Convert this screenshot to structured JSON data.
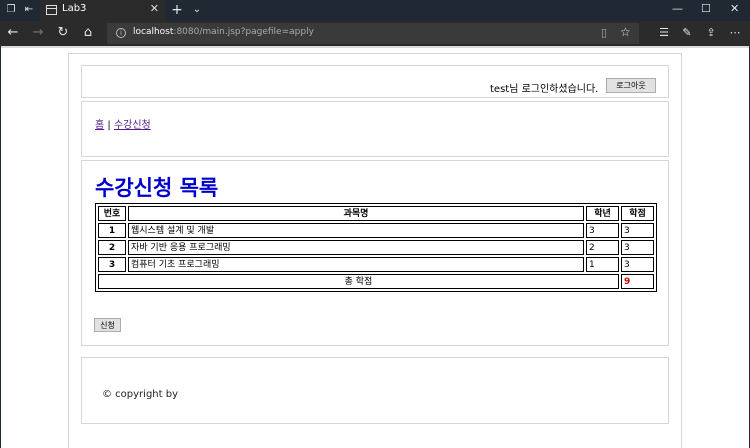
{
  "browser": {
    "tab_title": "Lab3",
    "url_host": "localhost",
    "url_path": ":8080/main.jsp?pagefile=apply",
    "icons": {
      "back": "←",
      "forward": "→",
      "refresh": "↻",
      "home": "⌂",
      "star": "☆",
      "new_tab": "+",
      "tab_list": "⌄",
      "close": "✕",
      "minimize": "—",
      "maximize": "☐"
    }
  },
  "header": {
    "login_message": "test님 로그인하셨습니다.",
    "logout_label": "로그아웃"
  },
  "nav": {
    "home": "홈",
    "separator": "|",
    "apply": "수강신청"
  },
  "content": {
    "title": "수강신청 목록",
    "columns": [
      "번호",
      "과목명",
      "학년",
      "학점"
    ],
    "rows": [
      {
        "no": "1",
        "name": "웹시스템 설계 및 개발",
        "year": "3",
        "credit": "3"
      },
      {
        "no": "2",
        "name": "자바 기반 응용 프로그래밍",
        "year": "2",
        "credit": "3"
      },
      {
        "no": "3",
        "name": "컴퓨터 기초 프로그래밍",
        "year": "1",
        "credit": "3"
      }
    ],
    "total_label": "총 학점",
    "total_value": "9",
    "apply_button": "신청"
  },
  "footer": {
    "copyright": "© copyright by"
  },
  "colors": {
    "title": "#0000cd",
    "total": "#c00000",
    "link": "#551a8b"
  }
}
